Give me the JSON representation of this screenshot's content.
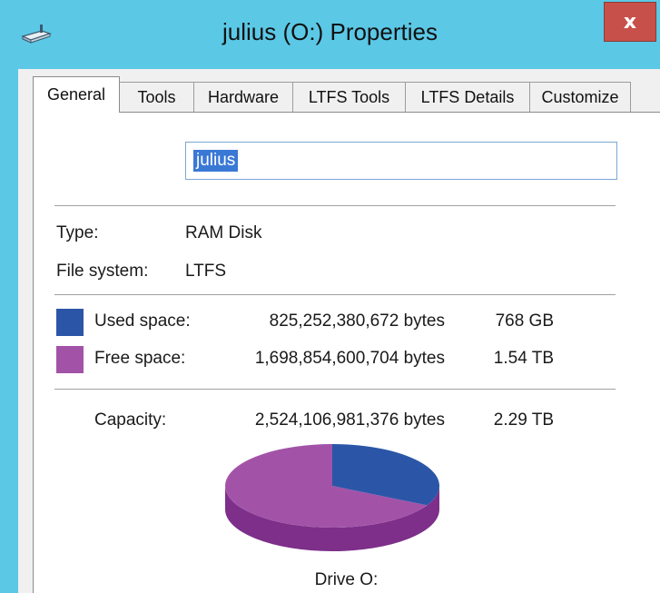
{
  "window": {
    "title": "julius (O:) Properties",
    "close_glyph": "x",
    "drive_icon": "drive-icon"
  },
  "tabs": [
    {
      "label": "General",
      "active": true
    },
    {
      "label": "Tools"
    },
    {
      "label": "Hardware"
    },
    {
      "label": "LTFS Tools"
    },
    {
      "label": "LTFS Details"
    },
    {
      "label": "Customize"
    }
  ],
  "general": {
    "name_value": "julius",
    "type_label": "Type:",
    "type_value": "RAM Disk",
    "fs_label": "File system:",
    "fs_value": "LTFS",
    "used": {
      "label": "Used space:",
      "bytes": "825,252,380,672 bytes",
      "size": "768 GB",
      "color": "#2b56a8"
    },
    "free": {
      "label": "Free space:",
      "bytes": "1,698,854,600,704 bytes",
      "size": "1.54 TB",
      "color": "#a253a8"
    },
    "capacity": {
      "label": "Capacity:",
      "bytes": "2,524,106,981,376 bytes",
      "size": "2.29 TB"
    },
    "used_fraction": 0.327,
    "drive_label": "Drive O:"
  },
  "colors": {
    "title_bar": "#5bc8e6",
    "close_button": "#c8504a",
    "used_dark": "#1d3f80",
    "free_dark": "#7d2f8a"
  }
}
